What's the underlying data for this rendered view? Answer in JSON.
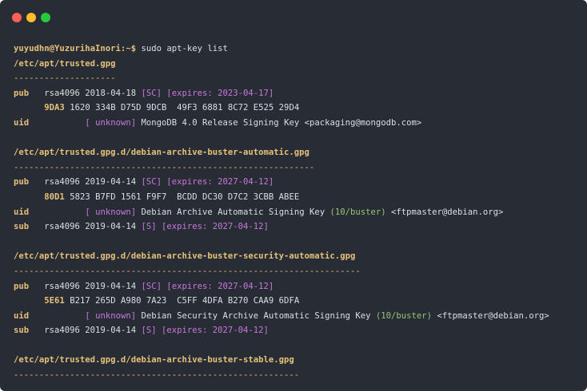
{
  "window": {
    "dot_colors": [
      "#ff5f56",
      "#ffbd2e",
      "#27c93f"
    ]
  },
  "terminal": {
    "prompt": "yuyudhn@YuzurihaInori:~$",
    "command": "sudo apt-key list",
    "keys": [
      {
        "path": "/etc/apt/trusted.gpg",
        "separator": "--------------------",
        "pub_label": "pub",
        "pub_spec": "rsa4096 2018-04-18",
        "pub_caps": "[SC] [expires: 2023-04-17]",
        "fp_short": "9DA3",
        "fp_rest": "1620 334B D75D 9DCB  49F3 6881 8C72 E525 29D4",
        "uid_label": "uid",
        "uid_trust": "[ unknown]",
        "uid_name": "MongoDB 4.0 Release Signing Key",
        "uid_comment": "",
        "uid_email": "<packaging@mongodb.com>"
      },
      {
        "path": "/etc/apt/trusted.gpg.d/debian-archive-buster-automatic.gpg",
        "separator": "-----------------------------------------------------------",
        "pub_label": "pub",
        "pub_spec": "rsa4096 2019-04-14",
        "pub_caps": "[SC] [expires: 2027-04-12]",
        "fp_short": "80D1",
        "fp_rest": "5823 B7FD 1561 F9F7  BCDD DC30 D7C2 3CBB ABEE",
        "uid_label": "uid",
        "uid_trust": "[ unknown]",
        "uid_name": "Debian Archive Automatic Signing Key",
        "uid_comment": "(10/buster)",
        "uid_email": "<ftpmaster@debian.org>",
        "sub_label": "sub",
        "sub_spec": "rsa4096 2019-04-14",
        "sub_caps": "[S] [expires: 2027-04-12]"
      },
      {
        "path": "/etc/apt/trusted.gpg.d/debian-archive-buster-security-automatic.gpg",
        "separator": "--------------------------------------------------------------------",
        "pub_label": "pub",
        "pub_spec": "rsa4096 2019-04-14",
        "pub_caps": "[SC] [expires: 2027-04-12]",
        "fp_short": "5E61",
        "fp_rest": "B217 265D A980 7A23  C5FF 4DFA B270 CAA9 6DFA",
        "uid_label": "uid",
        "uid_trust": "[ unknown]",
        "uid_name": "Debian Security Archive Automatic Signing Key",
        "uid_comment": "(10/buster)",
        "uid_email": "<ftpmaster@debian.org>",
        "sub_label": "sub",
        "sub_spec": "rsa4096 2019-04-14",
        "sub_caps": "[S] [expires: 2027-04-12]"
      },
      {
        "path": "/etc/apt/trusted.gpg.d/debian-archive-buster-stable.gpg",
        "separator": "--------------------------------------------------------"
      }
    ]
  }
}
